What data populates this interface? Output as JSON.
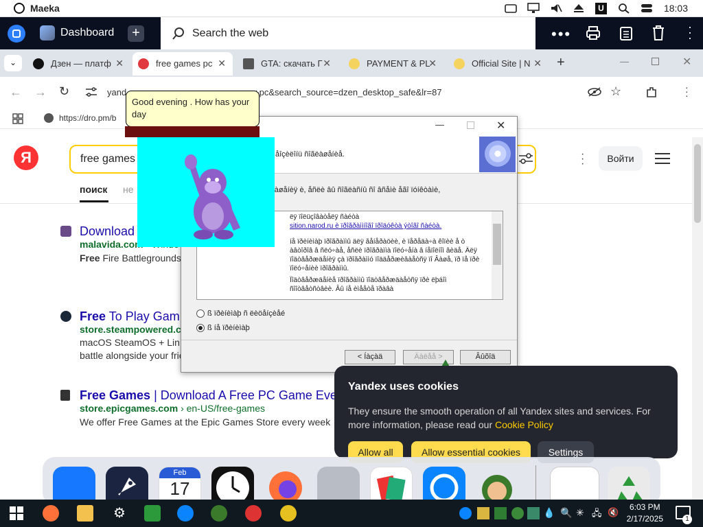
{
  "system_bar": {
    "app_name": "Maeka",
    "time": "18:03"
  },
  "header": {
    "title": "Dashboard",
    "search_placeholder": "Search the web"
  },
  "tabs": [
    {
      "label": "Дзен — платф",
      "icon_color": "#111111"
    },
    {
      "label": "free games pc",
      "icon_color": "#e0393e"
    },
    {
      "label": "GTA: скачать Г",
      "icon_color": "#555555"
    },
    {
      "label": "PAYMENT & PL",
      "icon_color": "#f4d35e"
    },
    {
      "label": "Official Site | N",
      "icon_color": "#f4d35e"
    }
  ],
  "address": {
    "url_start": "yand",
    "url_end": "+pc&search_source=dzen_desktop_safe&lr=87"
  },
  "bookmarks": {
    "item": "https://dro.pm/b"
  },
  "yandex": {
    "logo": "Я",
    "query": "free games",
    "login": "Войти",
    "tab_search": "поиск",
    "tab_other": "не"
  },
  "results": [
    {
      "title_a": "Download",
      "title_b": "",
      "url": "malavida.com",
      "url_rest": "› Windo",
      "desc_a": "Free",
      "desc_b": " Fire Battlegrounds"
    },
    {
      "title_a": "Free",
      "title_b": " To Play Gam",
      "url": "store.steampowered.c",
      "url_rest": "",
      "desc_a": "macOS SteamOS + Lin",
      "desc_b": "battle alongside your frie"
    },
    {
      "title_a": "Free Games",
      "title_b": " | Download A Free PC Game Eve",
      "url": "store.epicgames.com",
      "url_rest": "› en-US/free-games",
      "desc_a": "We offer Free Games at the Epic Games Store every week",
      "desc_b": ""
    }
  ],
  "installer": {
    "banner_text": "åîçèëîíü ñîãëàøåíèå.",
    "sub_text": "ñîãëàøåíèå èëîïêîì ñîãëàøåíèÿ è, åñëè âû ñîãëàñíû ñî âñåìè åãî ïóíêòàìè,",
    "license_lines": [
      "ëÿ ïîëüçîâàòåëÿ ñàéòà",
      "sition.narod.ru è ïðîãðàììíîãî ïðîäóêòà ýòîãî ñàéòà.",
      "íå ïðèíèìàþ ïðîãðàììû äëÿ ãåíåðàöèè, è ïåðåäà÷à êîïèè å ò àâòîðîâ â ñëó÷àå, åñëè ïðîãðàììà ïîëó÷åíà â íåïîëíîì âèäå. Äëÿ ïîäòâåðæäåíèÿ çà ïðîãðàììó ïîääåðæèâàåòñÿ ïî Âàøå, ïð ïå ïðè ïîëó÷åíèè ïðîãðàììû.",
      "Ïîäòâåðæäåíèå ïðîãðàììû ïîäòâåðæäàåòñÿ ïðè ëþáîì ñîîòâåòñòâèè. Âû íå èìååòå ïðàâà"
    ],
    "radio_accept": "ß ïðèíèìàþ ñ ëèöåíçèåé",
    "radio_decline": "ß íå ïðèíèìàþ",
    "btn_back": "< Íàçàä",
    "btn_next": "Äàëåå >",
    "btn_cancel": "Âûõîä"
  },
  "bonzi": {
    "speech": "Good evening . How has your day"
  },
  "cookie": {
    "title": "Yandex uses cookies",
    "desc": "They ensure the smooth operation of all Yandex sites and services. For more information, please read our",
    "policy": "Cookie Policy",
    "btn_allow": "Allow all",
    "btn_essential": "Allow essential cookies",
    "btn_settings": "Settings"
  },
  "dock": {
    "calendar_month": "Feb",
    "calendar_day": "17"
  },
  "taskbar": {
    "time": "6:03 PM",
    "date": "2/17/2025",
    "notif_count": "1"
  }
}
